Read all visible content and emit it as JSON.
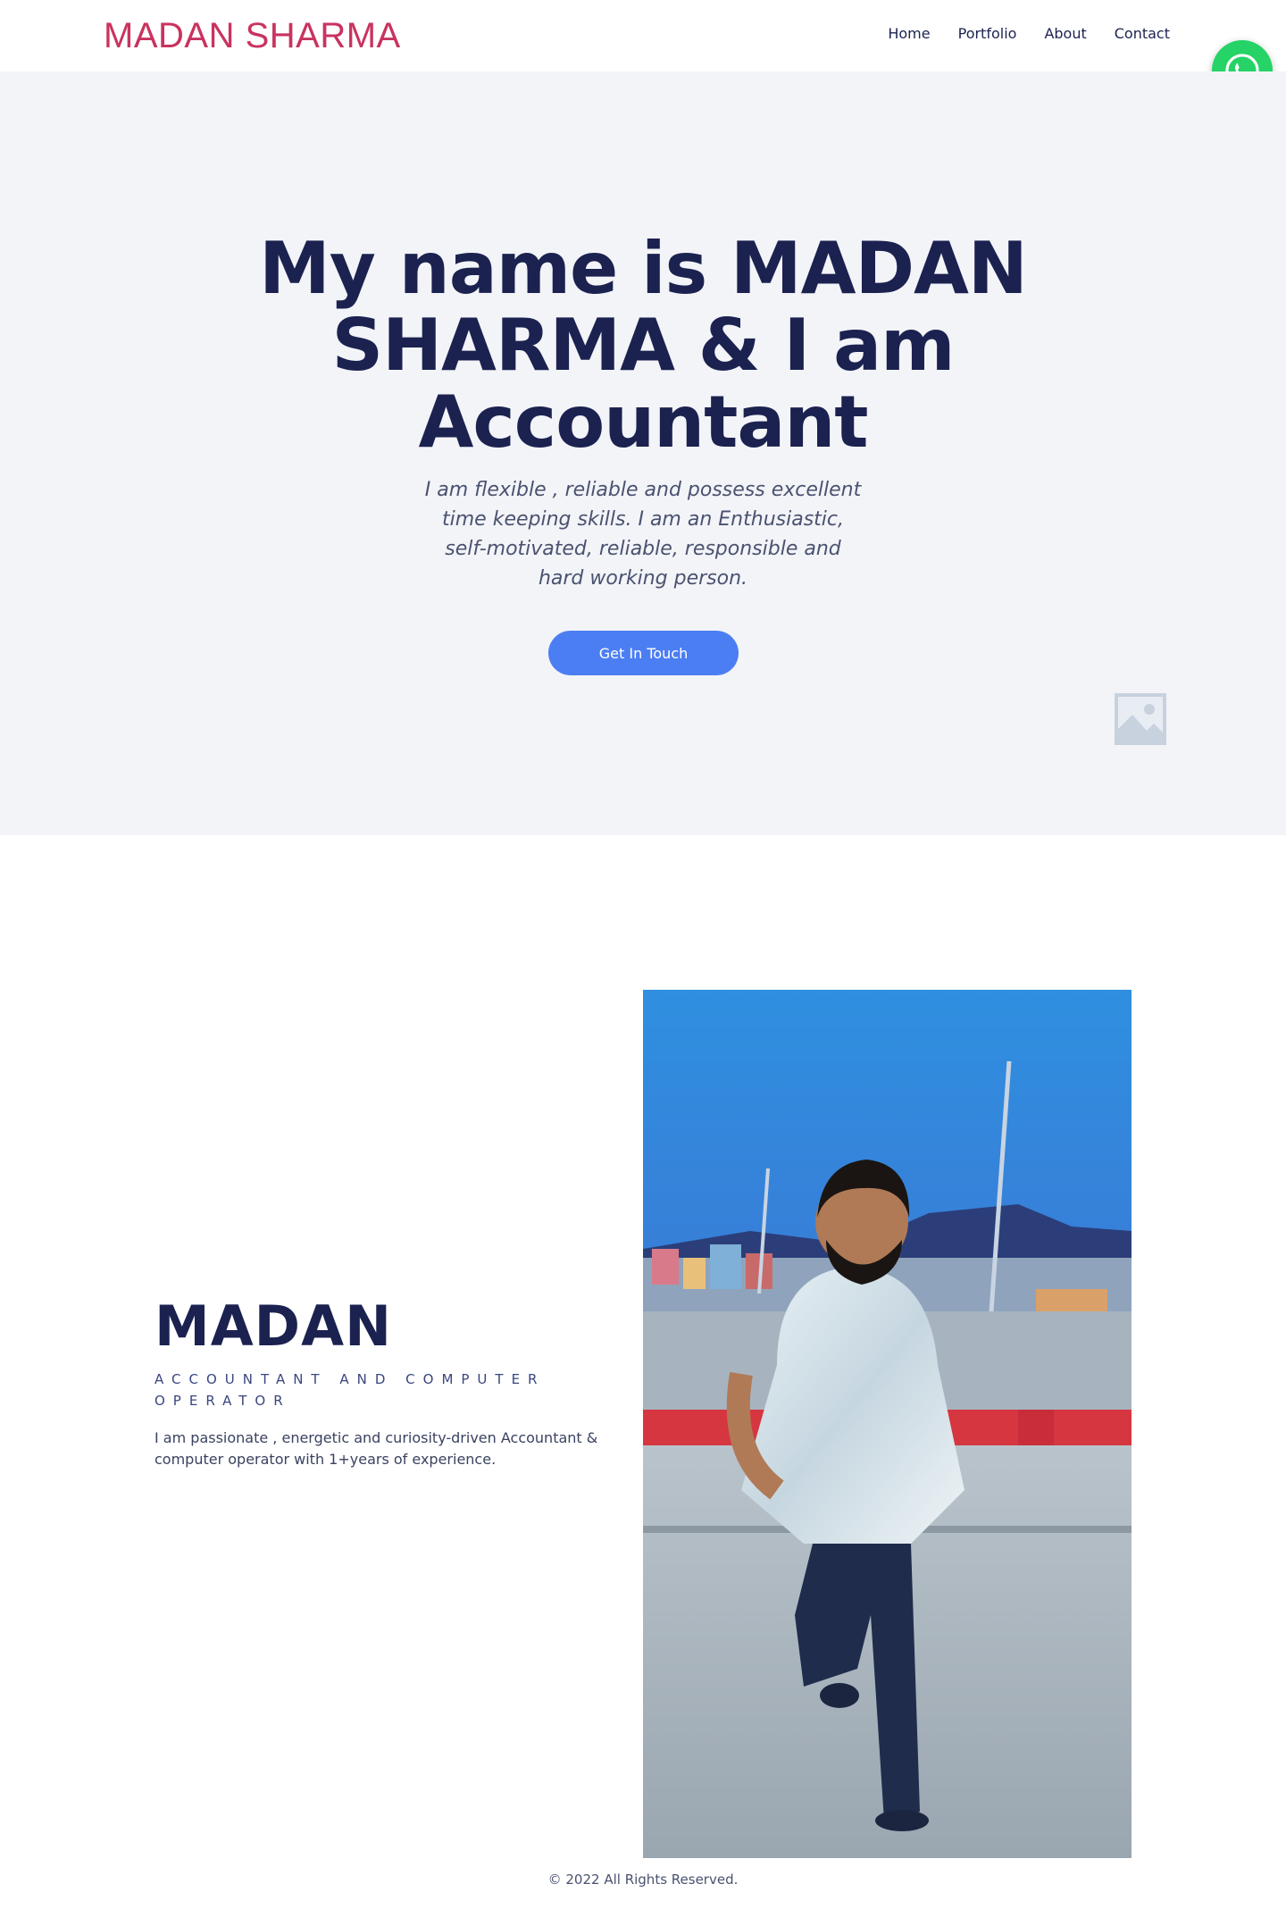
{
  "header": {
    "brand": "MADAN SHARMA",
    "nav": [
      {
        "label": "Home"
      },
      {
        "label": "Portfolio"
      },
      {
        "label": "About"
      },
      {
        "label": "Contact"
      }
    ]
  },
  "floating": {
    "whatsapp_icon": "whatsapp-icon",
    "color": "#25d366"
  },
  "hero": {
    "title_line1": "My name is MADAN",
    "title_line2": "SHARMA & I am",
    "title_line3": "Accountant",
    "description": "I am flexible , reliable and possess excellent time keeping skills. I am an Enthusiastic, self-motivated, reliable, responsible and hard working person.",
    "cta_label": "Get In Touch",
    "image_placeholder_icon": "image-icon"
  },
  "about": {
    "name": "MADAN",
    "role": "ACCOUNTANT AND COMPUTER OPERATOR",
    "description": "I am passionate , energetic and curiosity-driven Accountant & computer operator with 1+years of experience."
  },
  "footer": {
    "copyright": "© 2022 All Rights Reserved."
  },
  "colors": {
    "brand": "#c9335f",
    "heading": "#1b2250",
    "accent": "#4c7ef3",
    "hero_bg": "#f3f4f8"
  }
}
